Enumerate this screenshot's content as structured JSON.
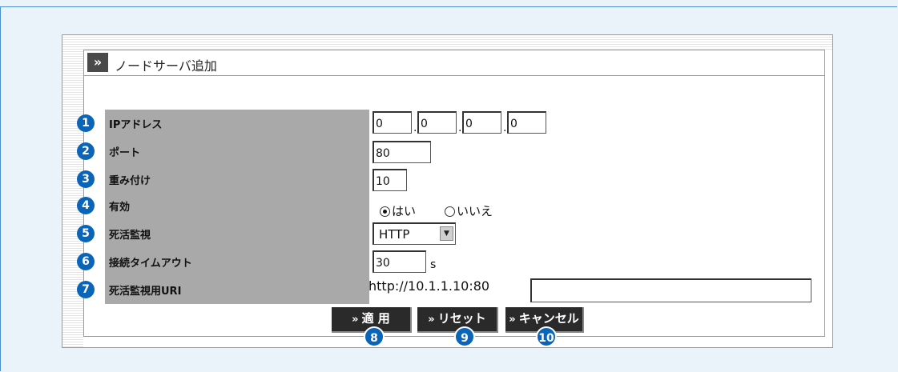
{
  "panel": {
    "title": "ノードサーバ追加"
  },
  "rows": [
    {
      "num": "1",
      "label": "IPアドレス"
    },
    {
      "num": "2",
      "label": "ポート"
    },
    {
      "num": "3",
      "label": "重み付け"
    },
    {
      "num": "4",
      "label": "有効"
    },
    {
      "num": "5",
      "label": "死活監視"
    },
    {
      "num": "6",
      "label": "接続タイムアウト"
    },
    {
      "num": "7",
      "label": "死活監視用URI"
    }
  ],
  "fields": {
    "ip": [
      "0",
      "0",
      "0",
      "0"
    ],
    "port": "80",
    "weight": "10",
    "enabled": {
      "yes": "はい",
      "no": "いいえ",
      "selected": "yes"
    },
    "health_check": "HTTP",
    "timeout": "30",
    "timeout_unit": "s",
    "uri_prefix": "http://10.1.1.10:80",
    "uri_value": ""
  },
  "buttons": {
    "apply": {
      "label": "適 用",
      "num": "8"
    },
    "reset": {
      "label": "リセット",
      "num": "9"
    },
    "cancel": {
      "label": "キャンセル",
      "num": "10"
    }
  }
}
